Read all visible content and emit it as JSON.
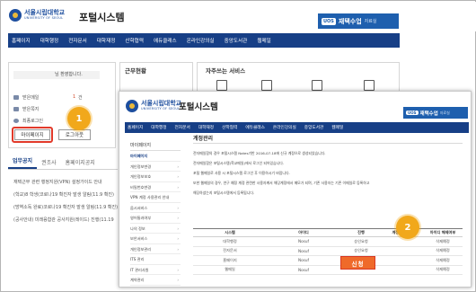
{
  "portal": {
    "logo_ko": "서울시립대학교",
    "logo_en": "UNIVERSITY OF SEOUL",
    "title": "포털시스템",
    "banner_tag": "UOS",
    "banner_text": "재택수업",
    "banner_sub": "자료실"
  },
  "nav": [
    "홈페이지",
    "대학행정",
    "전자문서",
    "대학재정",
    "산학협력",
    "에듀클래스",
    "온라인강의실",
    "중앙도서관",
    "웹메일"
  ],
  "profile": {
    "welcome": "님 환영합니다.",
    "stats": [
      {
        "label": "받은메일",
        "count": "1",
        "unit": "건"
      },
      {
        "label": "받은쪽지",
        "count": "",
        "unit": ""
      },
      {
        "label": "최종로그인",
        "count": "",
        "unit": ""
      }
    ],
    "mypage_label": "마이페이지",
    "logout_label": "로그아웃"
  },
  "panels": {
    "work_title": "근무현황",
    "service_title": "자주쓰는 서비스"
  },
  "notice": {
    "tabs": [
      "업무공지",
      "권조사",
      "홈페이지공지"
    ],
    "items": [
      "재택근무 관련 행정지원(VPN) 설정가이드 안내",
      "(학교)8 학생(코로나19 확진자 발생 알림(11.9 확진)",
      "(방역소독 완료)코로나19 확진자 발생 알림(11.9 확진)",
      "(공사안내) 미래융합관 공사지원(레이드) 진행(11.19"
    ]
  },
  "steps": {
    "one": "1",
    "two": "2"
  },
  "account": {
    "title": "계정관리",
    "sidebar_head": "마이페이지",
    "sidebar_items": [
      "마이페이지",
      "개인정보변경",
      "개인정보보호",
      "비밀번호변경",
      "VPN 계정 사용관리 안내",
      "옵시서비스",
      "영어통과여부",
      "나의 정보",
      "보안서비스",
      "개인정보관리",
      "ITS 관리",
      "IT 관리사원",
      "계약관리"
    ],
    "paragraphs": [
      "전자메일함의 경우 포털시스템 Notes기반 2016-07-18에 신규 계정으로 생성되었습니다.",
      "전자메일함은 포털시스템(학교메일)에서 로그인 되어있습니다.",
      "포털 웹메일로 사용 시 포털시스템 로그인 후 이용하시기 바랍니다.",
      "또한 웹메일의 경우, 연구 예정 계정 관련한 사용자께서 해당계정에서 메모가 되며, 기존 사용자는 기존 이메일로 등록하고",
      "해당하셨는지 포털시스템에서 등록됩니다."
    ],
    "columns": [
      "시스템",
      "아이디",
      "진행",
      "계정등록일자",
      "아이디 해제여부"
    ],
    "rows": [
      [
        "대학행정",
        "Nosuf",
        "승인요청",
        "",
        "삭제예정"
      ],
      [
        "전자문서",
        "Nosuf",
        "승인요청",
        "",
        "삭제예정"
      ],
      [
        "홈페이지",
        "Nosuf",
        "",
        "",
        "삭제예정"
      ],
      [
        "웹메일",
        "Nosuf",
        "",
        "",
        "삭제예정"
      ]
    ],
    "apply_label": "신청"
  }
}
